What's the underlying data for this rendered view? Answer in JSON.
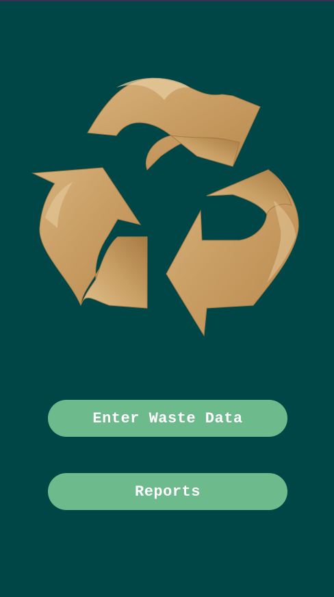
{
  "app": {
    "logo_icon": "recycle-icon",
    "background_color": "#004646",
    "accent_color": "#6dba8c"
  },
  "buttons": {
    "enter_waste_data": "Enter Waste Data",
    "reports": "Reports"
  }
}
